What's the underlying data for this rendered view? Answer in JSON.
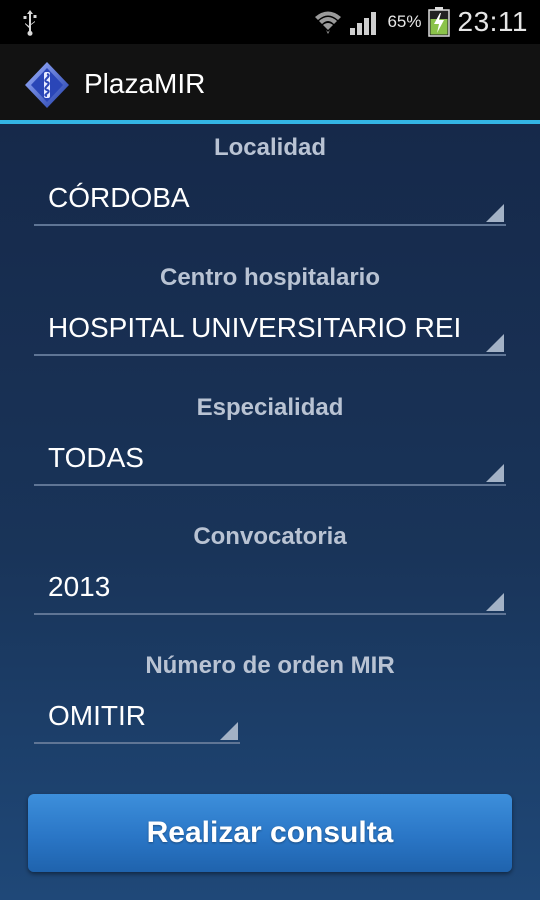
{
  "status_bar": {
    "battery_percent": "65%",
    "time": "23:11",
    "icons": [
      "usb-icon",
      "wifi-icon",
      "signal-icon",
      "battery-charging-icon"
    ]
  },
  "app": {
    "title": "PlazaMIR",
    "accent_color": "#33b5e5"
  },
  "form": {
    "localidad": {
      "label": "Localidad",
      "value": "CÓRDOBA"
    },
    "centro": {
      "label": "Centro hospitalario",
      "value": "HOSPITAL UNIVERSITARIO REI"
    },
    "especialidad": {
      "label": "Especialidad",
      "value": "TODAS"
    },
    "convocatoria": {
      "label": "Convocatoria",
      "value": "2013"
    },
    "orden": {
      "label": "Número de orden MIR",
      "value": "OMITIR"
    },
    "submit_label": "Realizar consulta"
  }
}
